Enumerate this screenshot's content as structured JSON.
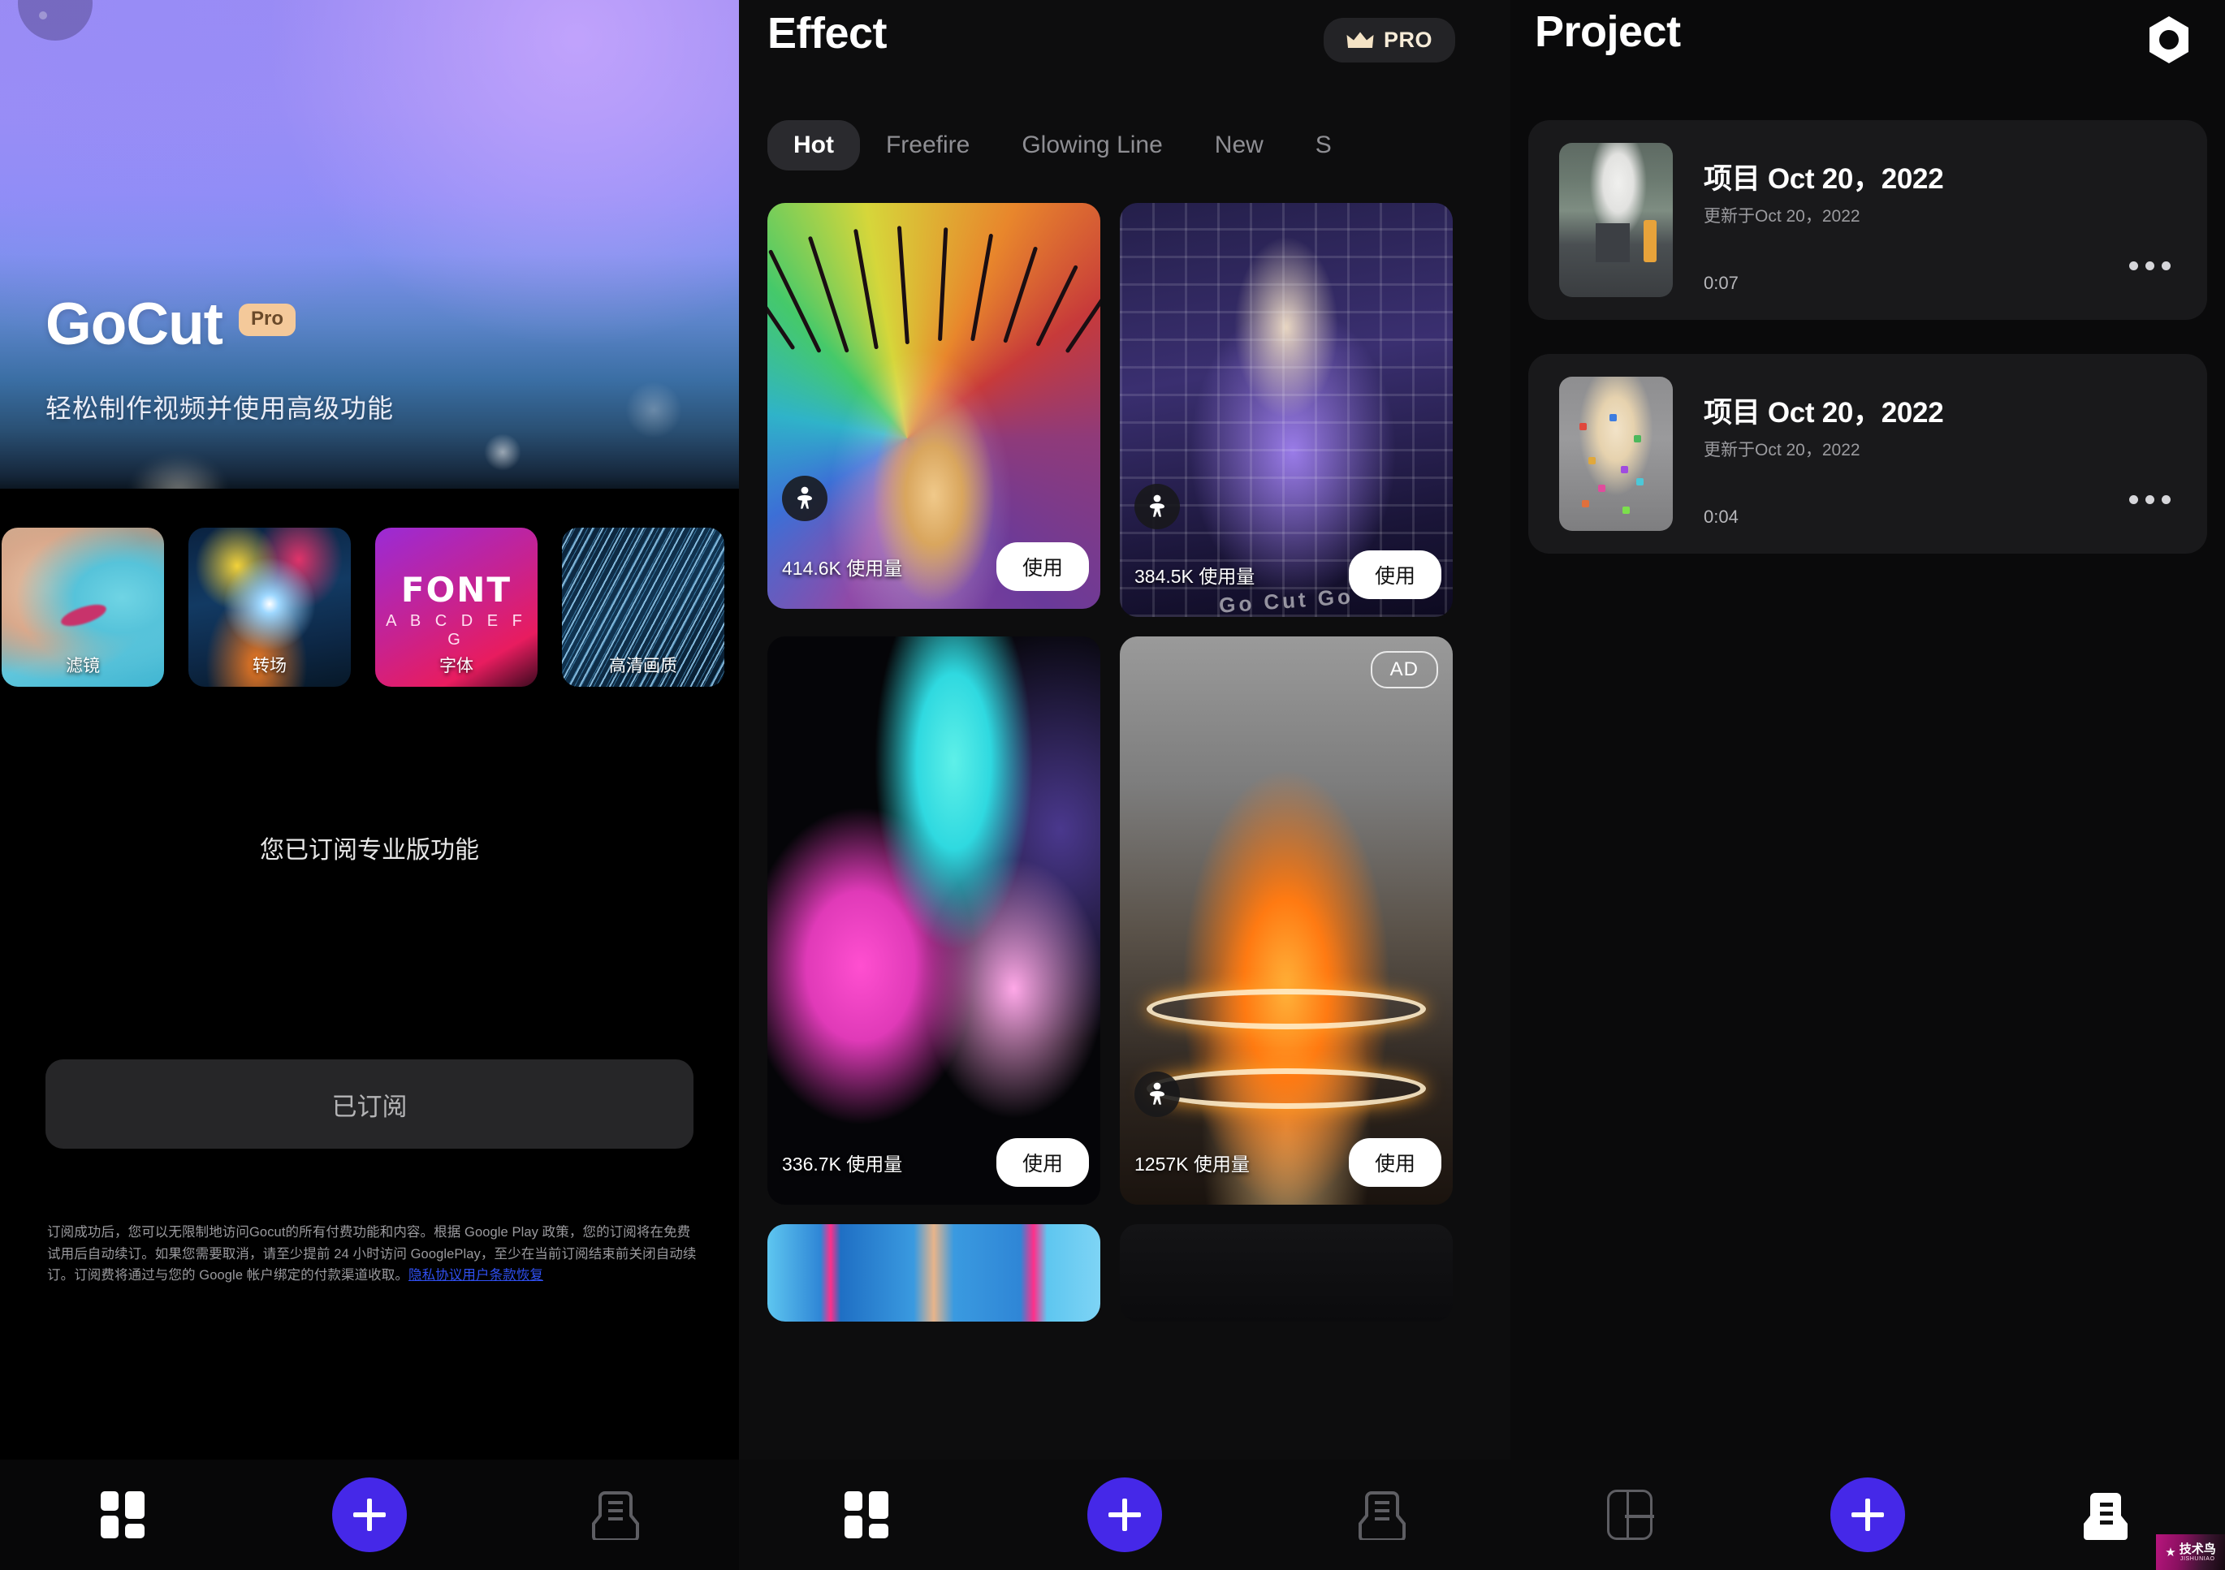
{
  "subscription_panel": {
    "brand": "GoCut",
    "pro_badge": "Pro",
    "tagline": "轻松制作视频并使用高级功能",
    "features": [
      {
        "label": "滤镜"
      },
      {
        "label": "转场"
      },
      {
        "label": "字体",
        "art_word": "FONT",
        "art_alphabet": "A B C D E F G"
      },
      {
        "label": "高清画质"
      }
    ],
    "status_text": "您已订阅专业版功能",
    "subscribe_button": "已订阅",
    "legal_text": "订阅成功后，您可以无限制地访问Gocut的所有付费功能和内容。根据 Google Play 政策，您的订阅将在免费试用后自动续订。如果您需要取消，请至少提前 24 小时访问 GooglePlay，至少在当前订阅结束前关闭自动续订。订阅费将通过与您的 Google 帐户绑定的付款渠道收取。",
    "legal_link": "隐私协议用户条款恢复",
    "bottom_nav": {
      "template_icon": "grid-icon",
      "create_label": "+",
      "inbox_icon": "inbox-icon",
      "active": "template"
    }
  },
  "effect_panel": {
    "title": "Effect",
    "pro_label": "PRO",
    "tabs": [
      {
        "label": "Hot",
        "active": true
      },
      {
        "label": "Freefire",
        "active": false
      },
      {
        "label": "Glowing Line",
        "active": false
      },
      {
        "label": "New",
        "active": false
      },
      {
        "label": "S",
        "active": false
      }
    ],
    "cards": [
      {
        "usage": "414.6K 使用量",
        "use_label": "使用",
        "has_person_icon": true,
        "is_ad": false
      },
      {
        "usage": "384.5K 使用量",
        "use_label": "使用",
        "has_person_icon": true,
        "is_ad": false,
        "watermark": "Go Cut  Go"
      },
      {
        "usage": "336.7K 使用量",
        "use_label": "使用",
        "has_person_icon": false,
        "is_ad": false
      },
      {
        "usage": "1257K 使用量",
        "use_label": "使用",
        "has_person_icon": true,
        "is_ad": true,
        "ad_label": "AD"
      }
    ],
    "bottom_nav": {
      "create_label": "+"
    }
  },
  "project_panel": {
    "title": "Project",
    "settings_icon": "hexagon-settings-icon",
    "projects": [
      {
        "name": "项目 Oct 20，2022",
        "updated": "更新于Oct 20，2022",
        "duration": "0:07"
      },
      {
        "name": "项目 Oct 20，2022",
        "updated": "更新于Oct 20，2022",
        "duration": "0:04"
      }
    ],
    "bottom_nav": {
      "template_icon": "grid-icon",
      "create_label": "+",
      "inbox_icon": "inbox-icon",
      "active": "inbox"
    },
    "watermark": {
      "star": "★",
      "cn": "技术鸟",
      "en": "JISHUNIAO"
    }
  },
  "colors": {
    "accent_purple": "#4528e8",
    "pro_gold": "#f7ecd8",
    "pro_chip": "#f4c99a",
    "link_blue": "#2f4ff0",
    "panel_bg": "#0d0d0e",
    "card_bg": "#19191b"
  }
}
